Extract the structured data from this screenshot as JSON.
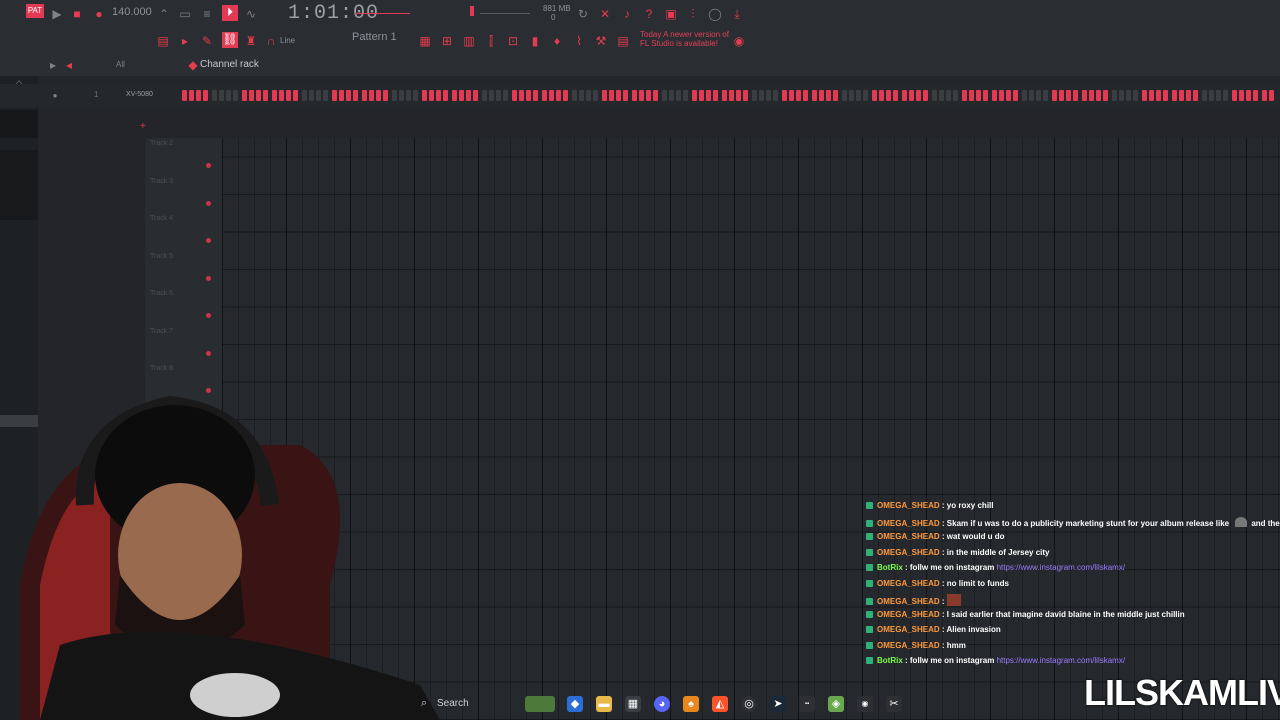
{
  "toolbar": {
    "tempo": "140.000",
    "song_time": "1:01:00",
    "memory": "881 MB",
    "memory_sub": "0",
    "pattern": "Pattern 1",
    "snap": "Line",
    "hint_line1": "Today  A newer version of",
    "hint_line2": "FL Studio is available!"
  },
  "channel_rack": {
    "filter": "All",
    "title": "Channel rack",
    "channel_number": "1",
    "channel_name": "XV-5080",
    "steps_on": [
      1,
      1,
      1,
      1,
      0,
      0,
      0,
      0,
      1,
      1,
      1,
      1
    ]
  },
  "playlist": {
    "tracks": [
      "Track 2",
      "Track 3",
      "Track 4",
      "Track 5",
      "Track 6",
      "Track 7",
      "Track 8"
    ]
  },
  "chat": [
    {
      "user": "OMEGA_SHEAD",
      "type": "omega",
      "text": "yo roxy chill"
    },
    {
      "user": "OMEGA_SHEAD",
      "type": "omega",
      "text": "Skam if u was to do a publicity marketing stunt for your album release like",
      "text2": "and the ice wall"
    },
    {
      "user": "OMEGA_SHEAD",
      "type": "omega",
      "text": "wat would u do"
    },
    {
      "user": "OMEGA_SHEAD",
      "type": "omega",
      "text": "in the middle of Jersey city"
    },
    {
      "user": "BotRix",
      "type": "bot",
      "text": "follw me on instagram",
      "link": "https://www.instagram.com/lilskamx/"
    },
    {
      "user": "OMEGA_SHEAD",
      "type": "omega",
      "text": "no limit to funds"
    },
    {
      "user": "OMEGA_SHEAD",
      "type": "omega",
      "text": ""
    },
    {
      "user": "OMEGA_SHEAD",
      "type": "omega",
      "text": "I said earlier that imagine david blaine in the middle just chillin"
    },
    {
      "user": "OMEGA_SHEAD",
      "type": "omega",
      "text": "Alien invasion"
    },
    {
      "user": "OMEGA_SHEAD",
      "type": "omega",
      "text": "hmm"
    },
    {
      "user": "BotRix",
      "type": "bot",
      "text": "follw me on instagram",
      "link": "https://www.instagram.com/lilskamx/"
    }
  ],
  "taskbar": {
    "search_label": "Search"
  },
  "branding": {
    "overlay_text": "LILSKAMLIVE"
  },
  "colors": {
    "accent": "#e23a55",
    "omega_user": "#ff9a3c",
    "bot_user": "#7cff4a",
    "link": "#9b7cff"
  }
}
